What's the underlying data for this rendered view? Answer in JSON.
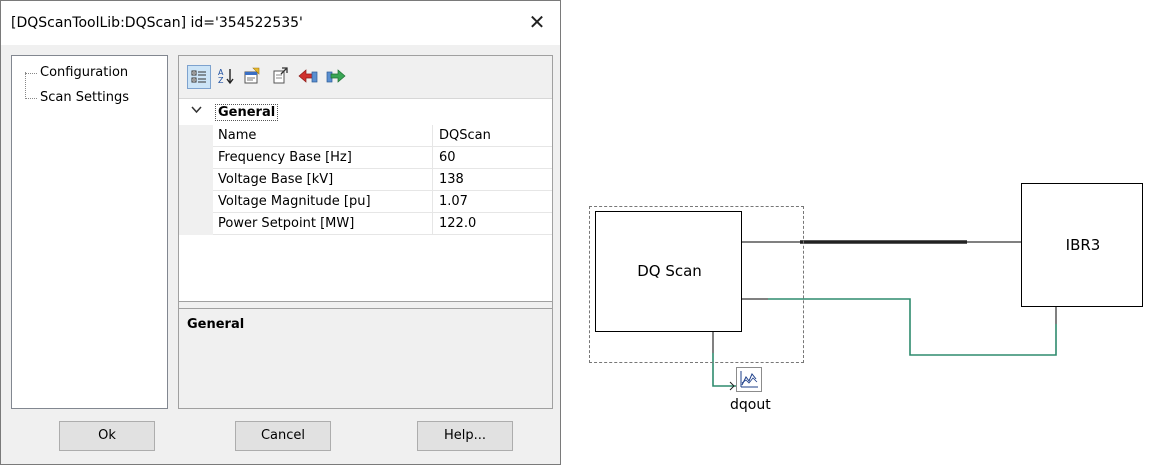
{
  "dialog": {
    "title": "[DQScanToolLib:DQScan] id='354522535'",
    "close_glyph": "✕"
  },
  "tree": {
    "items": [
      {
        "label": "Configuration"
      },
      {
        "label": "Scan Settings"
      }
    ]
  },
  "toolbar": {
    "icons": [
      "categorized-icon",
      "alphabetical-sort-icon",
      "property-pages-icon",
      "export-icon",
      "import-red-icon",
      "import-green-icon"
    ]
  },
  "grid": {
    "category": "General",
    "rows": [
      {
        "name": "Name",
        "value": "DQScan"
      },
      {
        "name": "Frequency Base [Hz]",
        "value": "60"
      },
      {
        "name": "Voltage Base [kV]",
        "value": "138"
      },
      {
        "name": "Voltage Magnitude [pu]",
        "value": "1.07"
      },
      {
        "name": "Power Setpoint [MW]",
        "value": "122.0"
      }
    ]
  },
  "description": {
    "title": "General"
  },
  "buttons": {
    "ok": "Ok",
    "cancel": "Cancel",
    "help": "Help..."
  },
  "diagram": {
    "dq_block_label": "DQ Scan",
    "ibr_block_label": "IBR3",
    "output_label": "dqout",
    "colors": {
      "wire": "#000000",
      "signal_wire": "#2e8b6e"
    }
  }
}
